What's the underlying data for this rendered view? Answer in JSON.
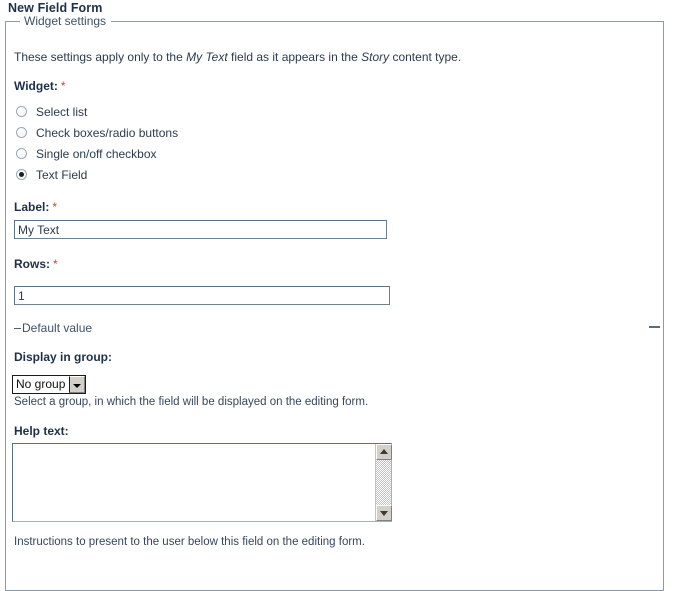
{
  "page": {
    "title": "New Field Form"
  },
  "fieldset": {
    "legend": "Widget settings",
    "intro": {
      "part1": "These settings apply only to the ",
      "field_name": "My Text",
      "part2": " field as it appears in the ",
      "content_type": "Story",
      "part3": " content type."
    }
  },
  "widget": {
    "label": "Widget:",
    "required_mark": "*",
    "options": [
      {
        "label": "Select list",
        "checked": false
      },
      {
        "label": "Check boxes/radio buttons",
        "checked": false
      },
      {
        "label": "Single on/off checkbox",
        "checked": false
      },
      {
        "label": "Text Field",
        "checked": true
      }
    ]
  },
  "label_field": {
    "label": "Label:",
    "required_mark": "*",
    "value": "My Text"
  },
  "rows_field": {
    "label": "Rows:",
    "required_mark": "*",
    "value": "1"
  },
  "default_value": {
    "legend": "Default value"
  },
  "display_group": {
    "label": "Display in group:",
    "selected": "No group",
    "description": "Select a group, in which the field will be displayed on the editing form."
  },
  "help_text": {
    "label": "Help text:",
    "value": "",
    "description": "Instructions to present to the user below this field on the editing form."
  },
  "colors": {
    "heading": "#1d3048",
    "body_text": "#2b3b4c",
    "required": "#c8453c",
    "border": "#8a9aa8",
    "input_border": "#5d7082"
  }
}
